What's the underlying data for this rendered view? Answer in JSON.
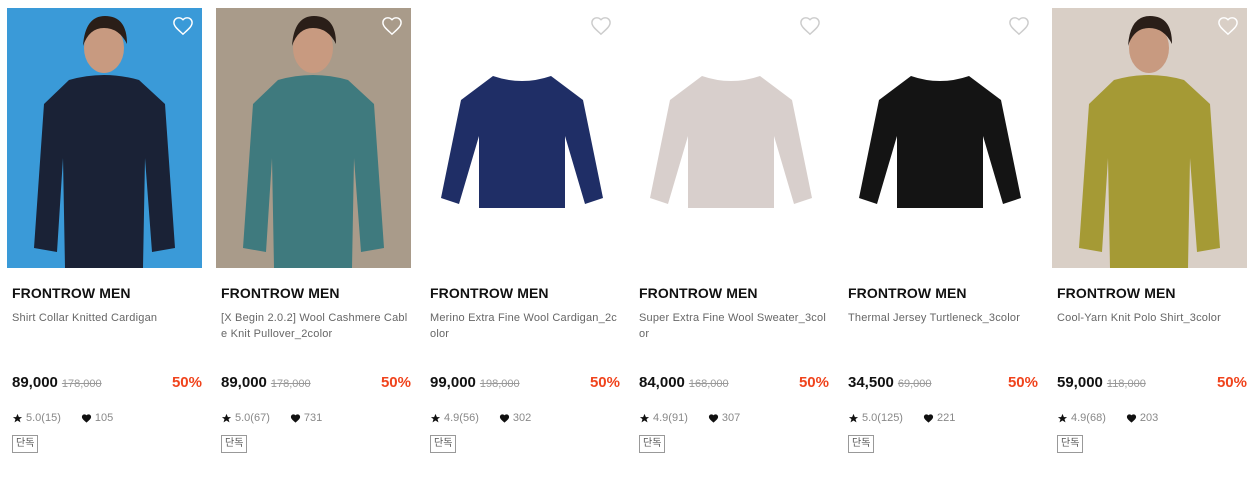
{
  "products": [
    {
      "brand": "FRONTROW MEN",
      "name": "Shirt Collar Knitted Cardigan",
      "price": "89,000",
      "original_price": "178,000",
      "discount": "50%",
      "rating": "5.0(15)",
      "likes": "105",
      "badge": "단독",
      "bg": "#3a9ad8",
      "garment": "#1a2236"
    },
    {
      "brand": "FRONTROW MEN",
      "name": "[X Begin 2.0.2] Wool Cashmere Cable Knit Pullover_2color",
      "price": "89,000",
      "original_price": "178,000",
      "discount": "50%",
      "rating": "5.0(67)",
      "likes": "731",
      "badge": "단독",
      "bg": "#a99b8a",
      "garment": "#3f7a7e"
    },
    {
      "brand": "FRONTROW MEN",
      "name": "Merino Extra Fine Wool Cardigan_2color",
      "price": "99,000",
      "original_price": "198,000",
      "discount": "50%",
      "rating": "4.9(56)",
      "likes": "302",
      "badge": "단독",
      "bg": "#ffffff",
      "garment": "#1f2e66"
    },
    {
      "brand": "FRONTROW MEN",
      "name": "Super Extra Fine Wool Sweater_3color",
      "price": "84,000",
      "original_price": "168,000",
      "discount": "50%",
      "rating": "4.9(91)",
      "likes": "307",
      "badge": "단독",
      "bg": "#ffffff",
      "garment": "#d8cfcc"
    },
    {
      "brand": "FRONTROW MEN",
      "name": "Thermal Jersey Turtleneck_3color",
      "price": "34,500",
      "original_price": "69,000",
      "discount": "50%",
      "rating": "5.0(125)",
      "likes": "221",
      "badge": "단독",
      "bg": "#ffffff",
      "garment": "#141414"
    },
    {
      "brand": "FRONTROW MEN",
      "name": "Cool-Yarn Knit Polo Shirt_3color",
      "price": "59,000",
      "original_price": "118,000",
      "discount": "50%",
      "rating": "4.9(68)",
      "likes": "203",
      "badge": "단독",
      "bg": "#d9cfc6",
      "garment": "#a59a35"
    }
  ],
  "icons": {
    "wishlist": "heart-outline-icon",
    "rating": "star-icon",
    "likes": "heart-filled-icon"
  },
  "colors": {
    "discount": "#f0431c",
    "text": "#111111",
    "muted": "#666666"
  }
}
